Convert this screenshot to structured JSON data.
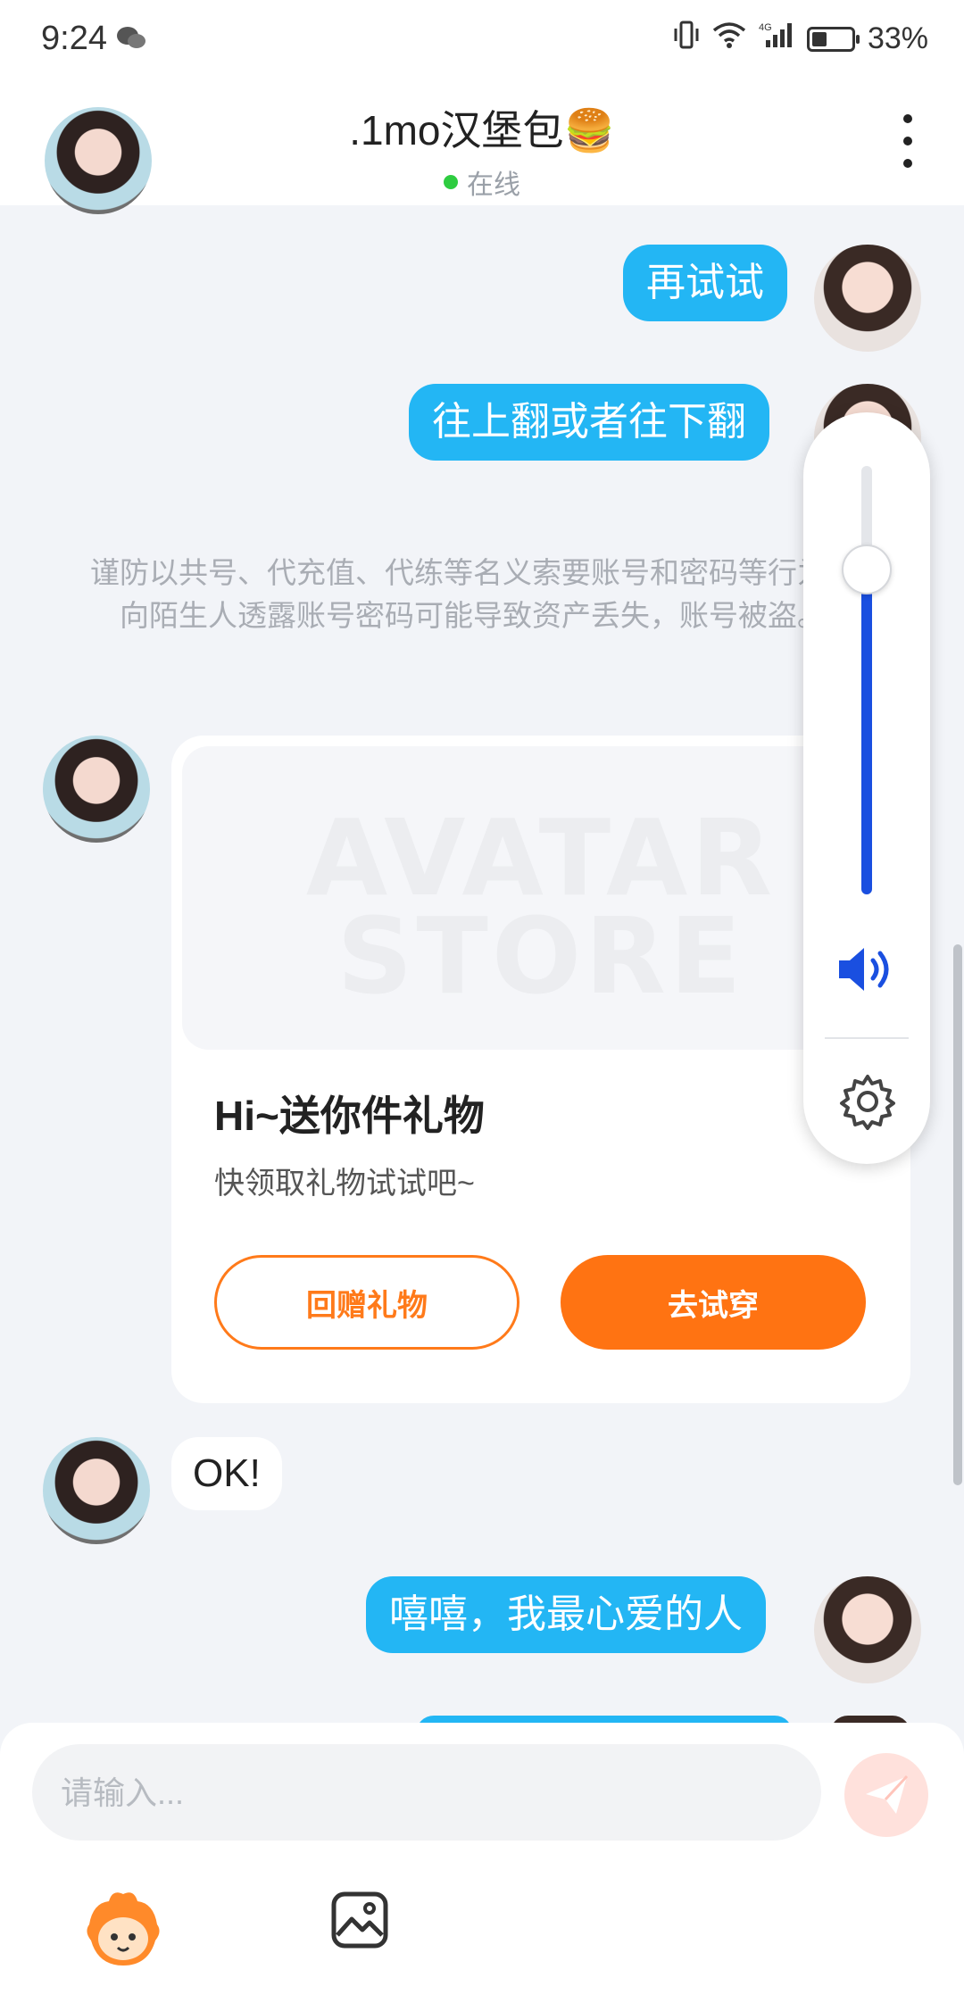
{
  "status_bar": {
    "time": "9:24",
    "battery": "33%",
    "network": "4G"
  },
  "header": {
    "title": ".1mo汉堡包🍔",
    "status": "在线",
    "status_color": "#2ecc40"
  },
  "messages": [
    {
      "side": "me",
      "text": "再试试"
    },
    {
      "side": "me",
      "text": "往上翻或者往下翻"
    },
    {
      "side": "system",
      "text": "谨防以共号、代充值、代练等名义索要账号和密码等行为，向陌生人透露账号密码可能导致资产丢失，账号被盗。"
    },
    {
      "side": "them",
      "type": "gift-card"
    },
    {
      "side": "them",
      "text": "OK!"
    },
    {
      "side": "me",
      "text": "嘻嘻，我最心爱的人"
    }
  ],
  "gift_card": {
    "watermark_line1": "AVATAR",
    "watermark_line2": "STORE",
    "title": "Hi~送你件礼物",
    "subtitle": "快领取礼物试试吧~",
    "return_button": "回赠礼物",
    "try_button": "去试穿",
    "accent_color": "#ff7312"
  },
  "volume_panel": {
    "level": 0.76,
    "icons": [
      "speaker-icon",
      "settings-gear-icon"
    ]
  },
  "composer": {
    "placeholder": "请输入...",
    "icons": [
      "send-icon",
      "avatar-sticker-icon",
      "image-icon"
    ]
  }
}
